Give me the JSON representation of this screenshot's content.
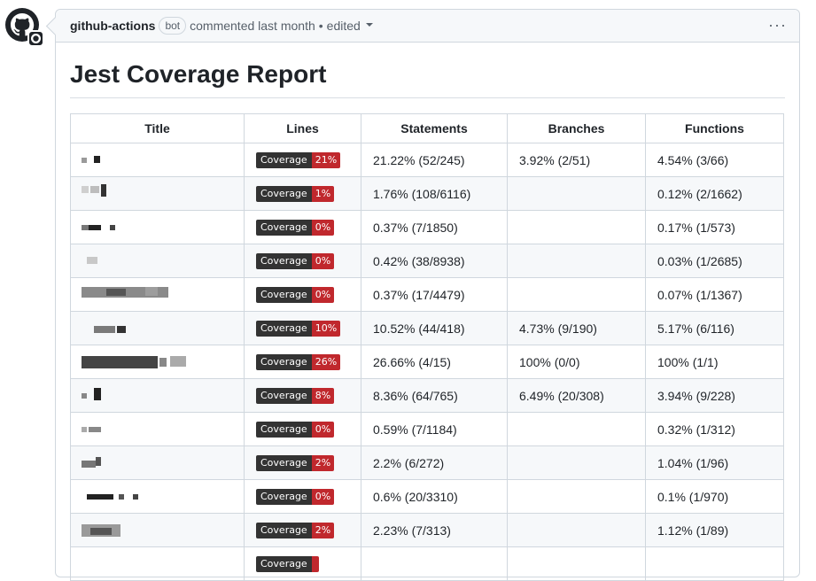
{
  "comment": {
    "author": "github-actions",
    "badge": "bot",
    "meta": "commented last month",
    "edited": "edited",
    "menu": "···"
  },
  "report": {
    "title": "Jest Coverage Report",
    "headers": [
      "Title",
      "Lines",
      "Statements",
      "Branches",
      "Functions"
    ],
    "badge_label": "Coverage",
    "rows": [
      {
        "coverage": "21%",
        "statements": "21.22% (52/245)",
        "branches": "3.92% (2/51)",
        "functions": "4.54% (3/66)"
      },
      {
        "coverage": "1%",
        "statements": "1.76% (108/6116)",
        "branches": "",
        "functions": "0.12% (2/1662)"
      },
      {
        "coverage": "0%",
        "statements": "0.37% (7/1850)",
        "branches": "",
        "functions": "0.17% (1/573)"
      },
      {
        "coverage": "0%",
        "statements": "0.42% (38/8938)",
        "branches": "",
        "functions": "0.03% (1/2685)"
      },
      {
        "coverage": "0%",
        "statements": "0.37% (17/4479)",
        "branches": "",
        "functions": "0.07% (1/1367)"
      },
      {
        "coverage": "10%",
        "statements": "10.52% (44/418)",
        "branches": "4.73% (9/190)",
        "functions": "5.17% (6/116)"
      },
      {
        "coverage": "26%",
        "statements": "26.66% (4/15)",
        "branches": "100% (0/0)",
        "functions": "100% (1/1)"
      },
      {
        "coverage": "8%",
        "statements": "8.36% (64/765)",
        "branches": "6.49% (20/308)",
        "functions": "3.94% (9/228)"
      },
      {
        "coverage": "0%",
        "statements": "0.59% (7/1184)",
        "branches": "",
        "functions": "0.32% (1/312)"
      },
      {
        "coverage": "2%",
        "statements": "2.2% (6/272)",
        "branches": "",
        "functions": "1.04% (1/96)"
      },
      {
        "coverage": "0%",
        "statements": "0.6% (20/3310)",
        "branches": "",
        "functions": "0.1% (1/970)"
      },
      {
        "coverage": "2%",
        "statements": "2.23% (7/313)",
        "branches": "",
        "functions": "1.12% (1/89)"
      },
      {
        "coverage": "",
        "statements": "",
        "branches": "",
        "functions": ""
      }
    ]
  },
  "colors": {
    "badge_label_bg": "#333333",
    "badge_value_bg": "#c0282d",
    "border": "#d0d7de"
  },
  "icons": {
    "avatar": "github-octocat-icon",
    "menu": "kebab-horizontal-icon",
    "caret": "caret-down-icon"
  }
}
